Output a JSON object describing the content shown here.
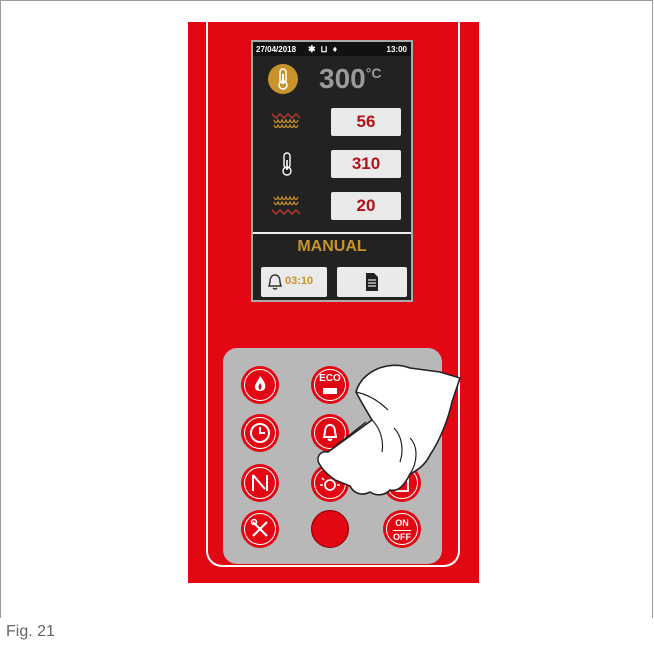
{
  "display": {
    "status": {
      "date": "27/04/2018",
      "time": "13:00"
    },
    "temperature": {
      "value": "300",
      "unit": "°C"
    },
    "rows": [
      {
        "icon": "heating-top-icon",
        "value": "56"
      },
      {
        "icon": "thermometer-icon",
        "value": "310"
      },
      {
        "icon": "heating-bottom-icon",
        "value": "20"
      }
    ],
    "mode": "MANUAL",
    "timer": "03:10"
  },
  "keypad": {
    "eco_label": "ECO",
    "onoff_top": "ON",
    "onoff_bottom": "OFF"
  },
  "caption": "Fig. 21",
  "colors": {
    "panel": "#e30613",
    "accent": "#c8932a",
    "value": "#b3121a"
  }
}
